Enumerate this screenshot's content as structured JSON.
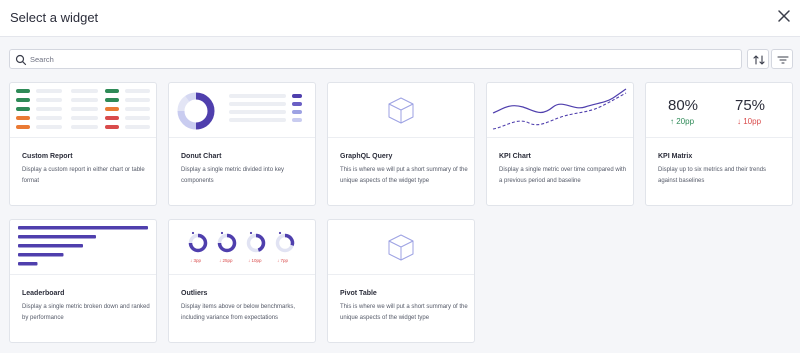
{
  "modal": {
    "title": "Select a widget",
    "search_placeholder": "Search"
  },
  "icons": [
    "close-icon",
    "search-icon",
    "sort-icon",
    "filter-icon",
    "cube-icon"
  ],
  "colors": {
    "accent": "#4f3fad",
    "green": "#2e8a57",
    "red": "#d94b4b",
    "orange": "#ea7a34",
    "light_purple": "#9da2e3"
  },
  "widgets": [
    {
      "title": "Custom Report",
      "description": "Display a custom report in either chart or table format"
    },
    {
      "title": "Donut Chart",
      "description": "Display a single metric divided into key components"
    },
    {
      "title": "GraphQL Query",
      "description": "This is where we will put a short summary of the unique aspects of the widget type"
    },
    {
      "title": "KPI Chart",
      "description": "Display a single metric over time compared with a previous period and baseline"
    },
    {
      "title": "KPI Matrix",
      "description": "Display up to six metrics and their trends against baselines"
    },
    {
      "title": "Leaderboard",
      "description": "Display a single metric broken down and ranked by performance"
    },
    {
      "title": "Outliers",
      "description": "Display items above or below benchmarks, including variance from expectations"
    },
    {
      "title": "Pivot Table",
      "description": "This is where we will put a short summary of the unique aspects of the widget type"
    }
  ],
  "kpi_matrix": {
    "metrics": [
      {
        "value": "80%",
        "delta": "↑ 20pp"
      },
      {
        "value": "75%",
        "delta": "↓ 10pp"
      }
    ]
  },
  "outliers": {
    "items": [
      {
        "delta": "↓ 3pp",
        "level": 0.75
      },
      {
        "delta": "↓ 25pp",
        "level": 0.75
      },
      {
        "delta": "↓ 10pp",
        "level": 0.45
      },
      {
        "delta": "↓ 7pp",
        "level": 0.3
      }
    ]
  },
  "leaderboard": {
    "levels": [
      1.0,
      0.6,
      0.5,
      0.35,
      0.15
    ]
  },
  "donut": {
    "segments": [
      0.5,
      0.25,
      0.15,
      0.1
    ]
  }
}
